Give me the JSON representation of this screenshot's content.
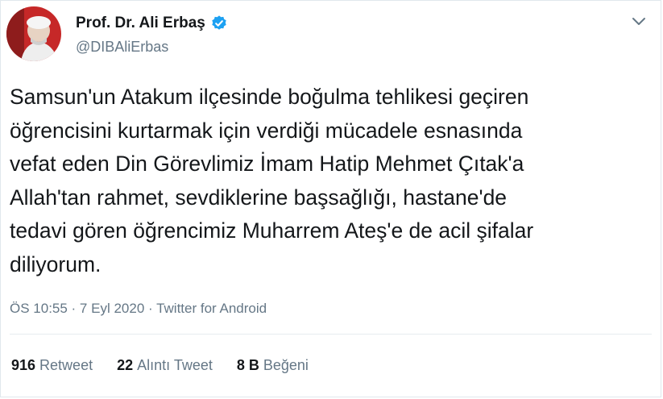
{
  "user": {
    "display_name": "Prof. Dr. Ali Erbaş",
    "handle": "@DIBAliErbas"
  },
  "tweet": {
    "lines": [
      "Samsun'un Atakum ilçesinde boğulma tehlikesi geçiren",
      "öğrencisini kurtarmak için verdiği mücadele esnasında",
      "vefat eden Din Görevlimiz İmam Hatip Mehmet Çıtak'a",
      "Allah'tan rahmet, sevdiklerine başsağlığı, hastane'de",
      "tedavi gören öğrencimiz Muharrem Ateş'e de acil şifalar",
      "diliyorum."
    ],
    "meta": "ÖS 10:55 · 7 Eyl 2020 · Twitter for Android"
  },
  "stats": {
    "retweets": {
      "count": "916",
      "label": "Retweet"
    },
    "quotes": {
      "count": "22",
      "label": "Alıntı Tweet"
    },
    "likes": {
      "count": "8 B",
      "label": "Beğeni"
    }
  },
  "icons": {
    "verified": "verified-badge-icon",
    "menu": "chevron-down-icon"
  },
  "colors": {
    "verified_blue": "#1da1f2",
    "secondary_text": "#657786",
    "primary_text": "#14171a"
  }
}
